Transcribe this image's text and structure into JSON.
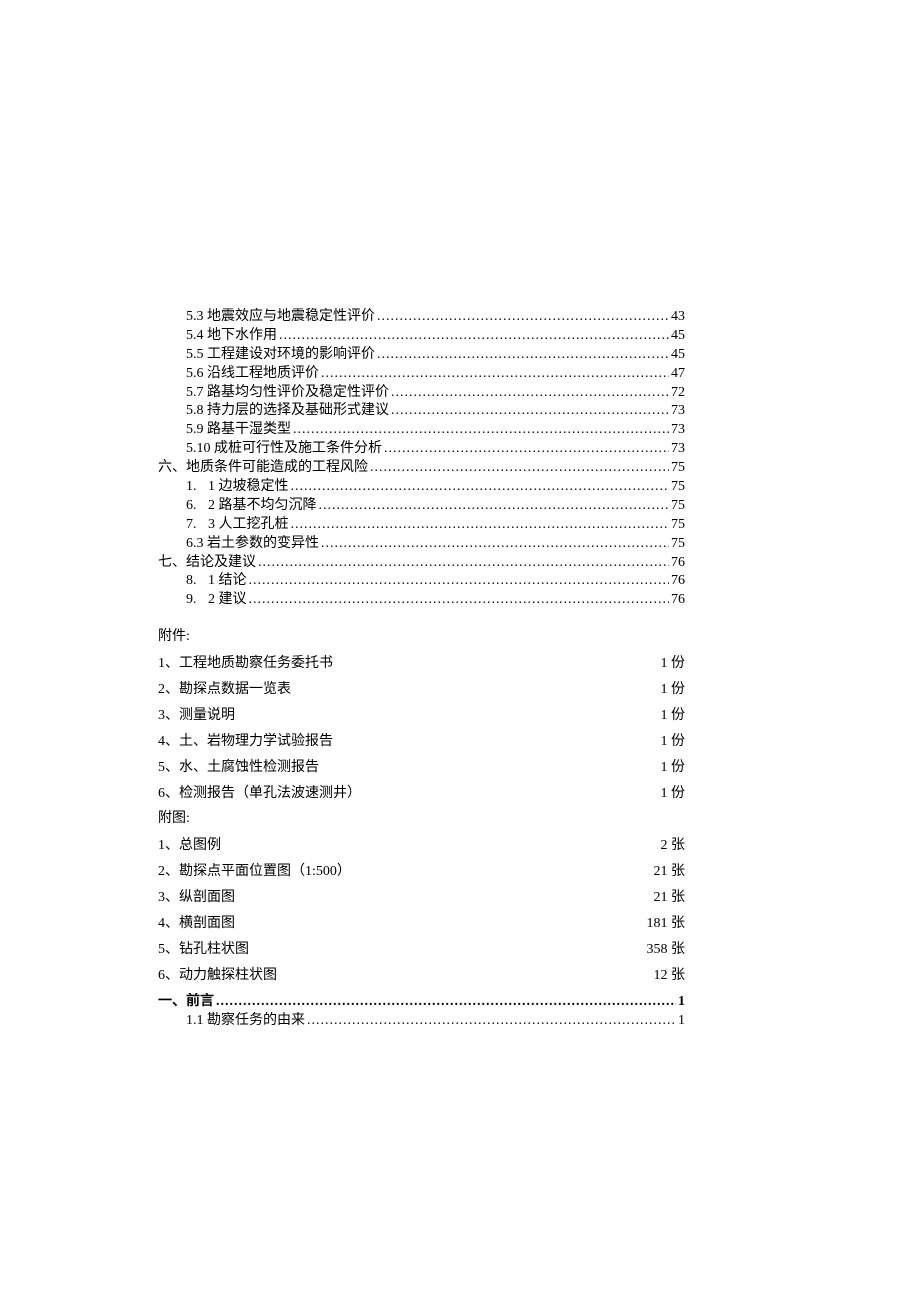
{
  "toc_top": [
    {
      "indent": 2,
      "label": "5.3 地震效应与地震稳定性评价",
      "page": "43"
    },
    {
      "indent": 2,
      "label": "5.4 地下水作用",
      "page": "45"
    },
    {
      "indent": 2,
      "label": "5.5 工程建设对环境的影响评价",
      "page": "45"
    },
    {
      "indent": 2,
      "label": "5.6 沿线工程地质评价",
      "page": "47"
    },
    {
      "indent": 2,
      "label": "5.7 路基均匀性评价及稳定性评价",
      "page": "72"
    },
    {
      "indent": 2,
      "label": "5.8 持力层的选择及基础形式建议",
      "page": "73"
    },
    {
      "indent": 2,
      "label": "5.9 路基干湿类型",
      "page": "73"
    },
    {
      "indent": 2,
      "label": "5.10 成桩可行性及施工条件分析",
      "page": "73"
    },
    {
      "indent": 1,
      "label": "六、地质条件可能造成的工程风险",
      "page": "75"
    },
    {
      "indent": 3,
      "prefix": "1.",
      "label": "1 边坡稳定性",
      "page": "75"
    },
    {
      "indent": 3,
      "prefix": "6.",
      "label": "2 路基不均匀沉降",
      "page": "75"
    },
    {
      "indent": 3,
      "prefix": "7.",
      "label": "3 人工挖孔桩",
      "page": "75"
    },
    {
      "indent": 2,
      "label": "6.3 岩土参数的变异性",
      "page": "75"
    },
    {
      "indent": 1,
      "label": "七、结论及建议",
      "page": "76"
    },
    {
      "indent": 3,
      "prefix": "8.",
      "label": "1 结论",
      "page": "76"
    },
    {
      "indent": 3,
      "prefix": "9.",
      "label": "2 建议",
      "page": "76"
    }
  ],
  "attach_heading_1": "附件:",
  "attachments_1": [
    {
      "label": "1、工程地质勘察任务委托书",
      "qty": "1 份"
    },
    {
      "label": "2、勘探点数据一览表",
      "qty": "1 份"
    },
    {
      "label": "3、测量说明",
      "qty": "1 份"
    },
    {
      "label": "4、土、岩物理力学试验报告",
      "qty": "1 份"
    },
    {
      "label": "5、水、土腐蚀性检测报告",
      "qty": "1 份"
    },
    {
      "label": "6、检测报告（单孔法波速测井）",
      "qty": "1 份"
    }
  ],
  "attach_heading_2": "附图:",
  "attachments_2": [
    {
      "label": "1、总图例",
      "qty": "2 张"
    },
    {
      "label": "2、勘探点平面位置图（1:500）",
      "qty": "21 张"
    },
    {
      "label": "3、纵剖面图",
      "qty": "21 张"
    },
    {
      "label": "4、横剖面图",
      "qty": "181 张"
    },
    {
      "label": "5、钻孔柱状图",
      "qty": "358 张"
    },
    {
      "label": "6、动力触探柱状图",
      "qty": "12 张"
    }
  ],
  "toc_bottom": [
    {
      "indent": 1,
      "label": "一、前言",
      "page": "1",
      "bold": true
    },
    {
      "indent": 2,
      "label": "1.1 勘察任务的由来",
      "page": "1"
    }
  ]
}
